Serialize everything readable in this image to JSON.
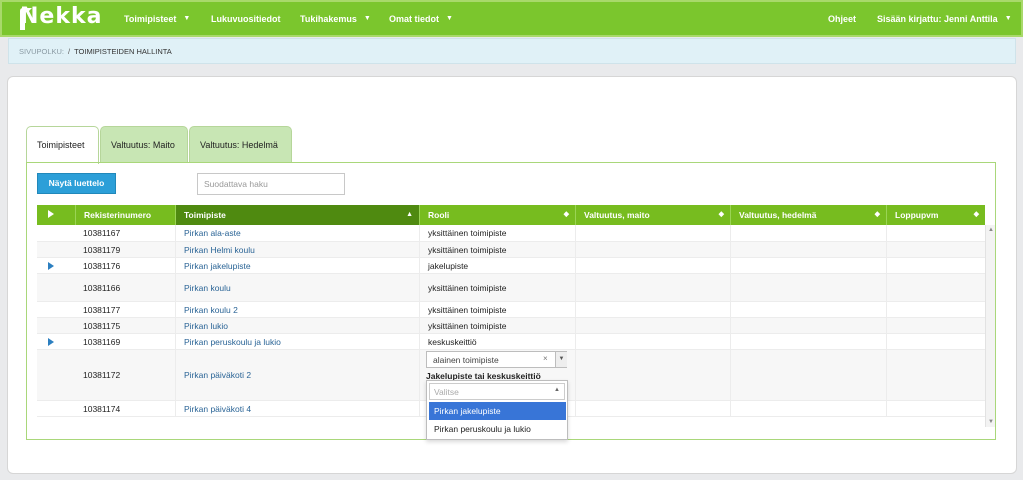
{
  "brand": {
    "logo_text": "Nekka"
  },
  "nav": {
    "items": [
      {
        "label": "Toimipisteet",
        "has_caret": true
      },
      {
        "label": "Lukuvuositiedot",
        "has_caret": false
      },
      {
        "label": "Tukihakemus",
        "has_caret": true
      },
      {
        "label": "Omat tiedot",
        "has_caret": true
      }
    ],
    "help": "Ohjeet",
    "user": "Sisään kirjattu: Jenni Anttila"
  },
  "breadcrumb": {
    "label": "SIVUPOLKU:",
    "separator": "/",
    "current": "TOIMIPISTEIDEN HALLINTA"
  },
  "tabs": [
    {
      "label": "Toimipisteet",
      "active": true
    },
    {
      "label": "Valtuutus: Maito",
      "active": false
    },
    {
      "label": "Valtuutus: Hedelmä",
      "active": false
    }
  ],
  "toolbar": {
    "show_list_label": "Näytä luettelo",
    "filter_placeholder": "Suodattava haku"
  },
  "table": {
    "columns": [
      "Rekisterinumero",
      "Toimipiste",
      "Rooli",
      "Valtuutus, maito",
      "Valtuutus, hedelmä",
      "Loppupvm"
    ],
    "sorted_column": "Toimipiste",
    "rows": [
      {
        "reg": "10381167",
        "name": "Pirkan ala-aste",
        "role": "yksittäinen toimipiste",
        "expandable": false
      },
      {
        "reg": "10381179",
        "name": "Pirkan Helmi koulu",
        "role": "yksittäinen toimipiste",
        "expandable": false
      },
      {
        "reg": "10381176",
        "name": "Pirkan jakelupiste",
        "role": "jakelupiste",
        "expandable": true
      },
      {
        "reg": "10381166",
        "name": "Pirkan koulu",
        "role": "yksittäinen toimipiste",
        "expandable": false
      },
      {
        "reg": "10381177",
        "name": "Pirkan koulu 2",
        "role": "yksittäinen toimipiste",
        "expandable": false
      },
      {
        "reg": "10381175",
        "name": "Pirkan lukio",
        "role": "yksittäinen toimipiste",
        "expandable": false
      },
      {
        "reg": "10381169",
        "name": "Pirkan peruskoulu ja lukio",
        "role": "keskuskeittiö",
        "expandable": true
      },
      {
        "reg": "10381172",
        "name": "Pirkan päiväkoti 2",
        "role": "",
        "expandable": false
      },
      {
        "reg": "10381174",
        "name": "Pirkan päiväkoti 4",
        "role": "",
        "expandable": false
      }
    ]
  },
  "role_editor": {
    "selected_value": "alainen toimipiste",
    "clear_symbol": "×",
    "group_label": "Jakelupiste tai keskuskeittiö",
    "search_placeholder": "Valitse",
    "options": [
      "Pirkan jakelupiste",
      "Pirkan peruskoulu ja lukio"
    ],
    "highlighted_option": "Pirkan jakelupiste"
  },
  "colors": {
    "topbar": "#7bc62d",
    "header": "#77bc1f",
    "header_sorted": "#4f8a10",
    "button": "#2c9fd8",
    "link": "#2a6496"
  }
}
